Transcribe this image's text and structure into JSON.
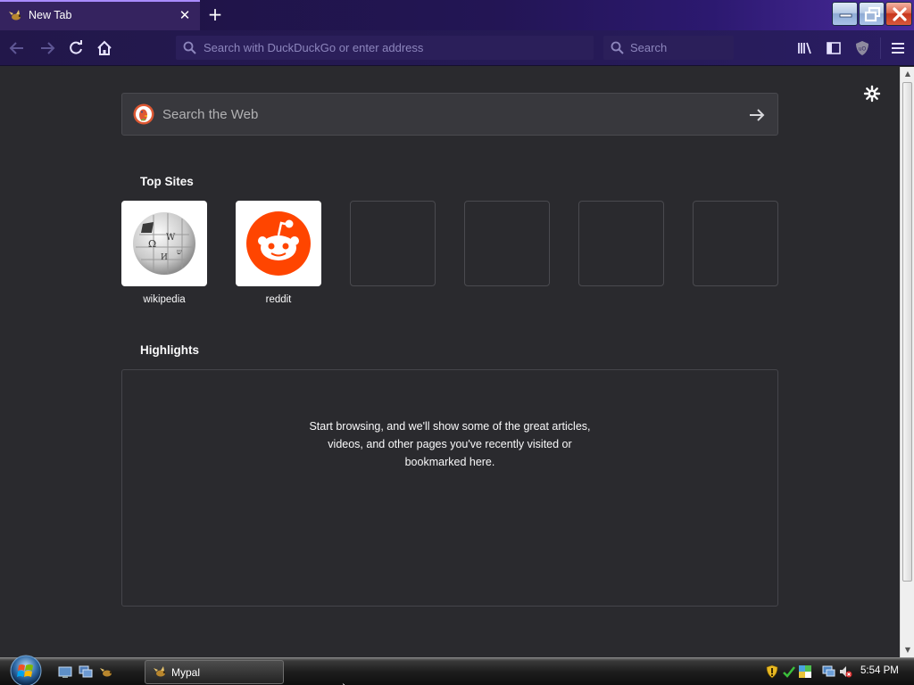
{
  "browser": {
    "tab_title": "New Tab",
    "tab_close_icon": "close-icon",
    "new_tab_icon": "plus-icon",
    "url_placeholder": "Search with DuckDuckGo or enter address",
    "search_placeholder": "Search",
    "accent_color": "#a98bff",
    "toolbar_bg": "#251a55"
  },
  "window_controls": [
    "minimize-icon",
    "restore-icon",
    "close-icon"
  ],
  "toolbar_icons": {
    "left": [
      "back-arrow-icon",
      "forward-arrow-icon",
      "reload-icon",
      "home-icon"
    ],
    "right": [
      "library-icon",
      "sidebar-icon",
      "ublock-icon",
      "hamburger-menu-icon"
    ]
  },
  "newtab": {
    "search_placeholder": "Search the Web",
    "top_sites_title": "Top Sites",
    "top_sites": [
      {
        "label": "wikipedia",
        "icon": "wikipedia-globe-icon"
      },
      {
        "label": "reddit",
        "icon": "reddit-alien-icon"
      },
      {
        "label": ""
      },
      {
        "label": ""
      },
      {
        "label": ""
      },
      {
        "label": ""
      }
    ],
    "highlights_title": "Highlights",
    "highlights_lines": [
      "Start browsing, and we'll show some of the great articles,",
      "videos, and other pages you've recently visited or",
      "bookmarked here."
    ]
  },
  "taskbar": {
    "task_label": "Mypal",
    "clock": "5:54 PM",
    "tray_icons": [
      "security-shield-icon",
      "network-icon",
      "volume-muted-icon"
    ]
  }
}
